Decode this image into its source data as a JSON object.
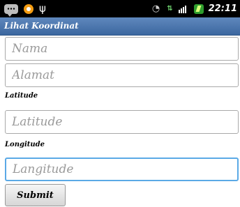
{
  "status_bar": {
    "time": "22:11",
    "icons": [
      "chat-icon",
      "orange-notification-icon",
      "usb-icon",
      "signal-wave-icon",
      "network-activity-icon",
      "signal-bars-icon",
      "battery-charging-icon"
    ]
  },
  "title_bar": {
    "title": "Lihat Koordinat"
  },
  "form": {
    "nama_placeholder": "Nama",
    "alamat_placeholder": "Alamat",
    "latitude_label": "Latitude",
    "latitude_placeholder": "Latitude",
    "longitude_label": "Longitude",
    "longitude_placeholder": "Langitude",
    "submit_label": "Submit"
  },
  "colors": {
    "status_bar": "#000000",
    "title_bar": "#4f7ab3",
    "focus_border": "#5aa9e6"
  }
}
